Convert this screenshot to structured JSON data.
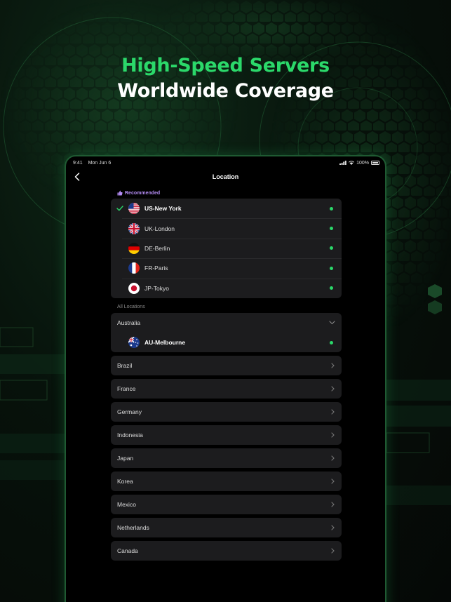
{
  "headline": {
    "line1": "High-Speed Servers",
    "line2": "Worldwide Coverage"
  },
  "colors": {
    "accent_green": "#2bd86a",
    "recommended_purple": "#b58df5",
    "card_bg": "#1c1c1e",
    "screen_bg": "#000000"
  },
  "status_bar": {
    "time": "9:41",
    "date": "Mon Jun 6",
    "battery": "100%"
  },
  "nav": {
    "title": "Location",
    "back_icon": "chevron-left-icon"
  },
  "recommended": {
    "label": "Recommended",
    "icon": "thumbs-up-icon",
    "servers": [
      {
        "name": "US-New York",
        "flag": "us-flag-icon",
        "selected": true,
        "status": "online"
      },
      {
        "name": "UK-London",
        "flag": "uk-flag-icon",
        "selected": false,
        "status": "online"
      },
      {
        "name": "DE-Berlin",
        "flag": "de-flag-icon",
        "selected": false,
        "status": "online"
      },
      {
        "name": "FR-Paris",
        "flag": "fr-flag-icon",
        "selected": false,
        "status": "online"
      },
      {
        "name": "JP-Tokyo",
        "flag": "jp-flag-icon",
        "selected": false,
        "status": "online"
      }
    ]
  },
  "all_locations": {
    "label": "All Locations",
    "expanded": {
      "country": "Australia",
      "servers": [
        {
          "name": "AU-Melbourne",
          "flag": "au-flag-icon",
          "status": "online"
        }
      ]
    },
    "countries": [
      "Brazil",
      "France",
      "Germany",
      "Indonesia",
      "Japan",
      "Korea",
      "Mexico",
      "Netherlands",
      "Canada"
    ]
  }
}
